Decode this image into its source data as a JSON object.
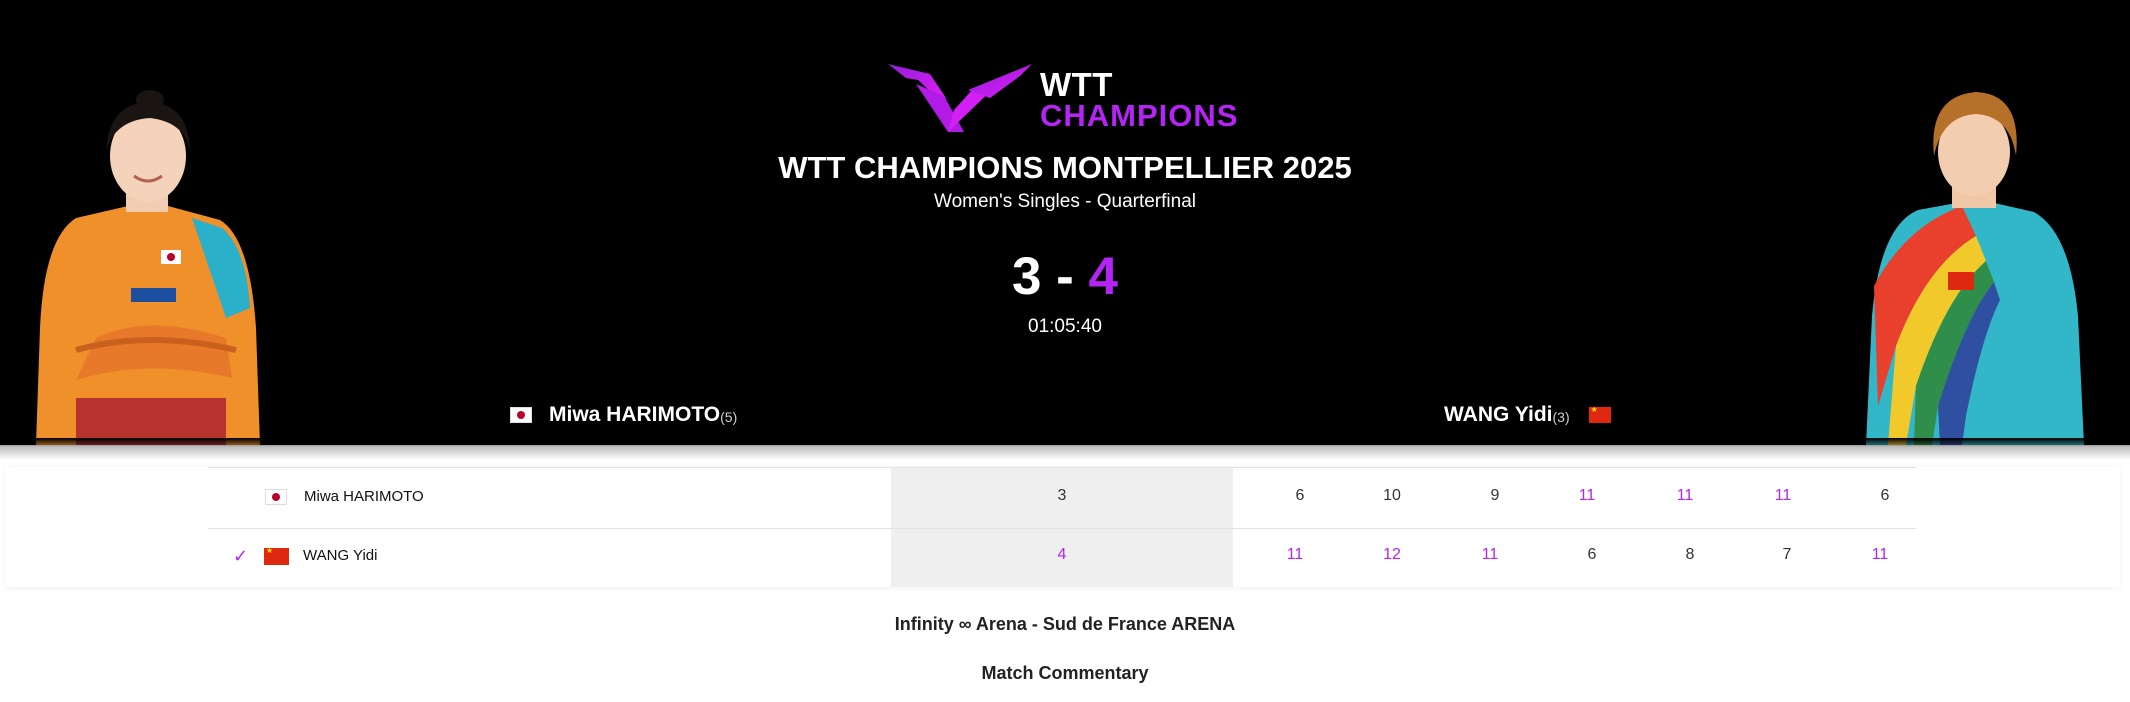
{
  "brand": {
    "logo_top": "WTT",
    "logo_bottom": "CHAMPIONS",
    "accent_color": "#b424f4",
    "logo_mark_color": "#c21ef0"
  },
  "event": {
    "title": "WTT CHAMPIONS MONTPELLIER 2025",
    "subtitle": "Women's Singles - Quarterfinal"
  },
  "match": {
    "score_p1": "3",
    "score_sep": " - ",
    "score_p2": "4",
    "duration": "01:05:40",
    "winner": "player2"
  },
  "players": {
    "p1": {
      "name": "Miwa HARIMOTO",
      "seed": "(5)",
      "flag": "jp-flag-icon",
      "table_name": "Miwa HARIMOTO"
    },
    "p2": {
      "name": "WANG Yidi",
      "seed": "(3)",
      "flag": "cn-flag-icon",
      "table_name": "WANG Yidi"
    }
  },
  "results": {
    "p1": {
      "sets": "3",
      "games": [
        "6",
        "10",
        "9",
        "11",
        "11",
        "11",
        "6"
      ]
    },
    "p2": {
      "sets": "4",
      "games": [
        "11",
        "12",
        "11",
        "6",
        "8",
        "7",
        "11"
      ]
    },
    "winner_icon": "check-icon"
  },
  "footer": {
    "venue": "Infinity ∞ Arena - Sud de France ARENA",
    "commentary": "Match Commentary"
  }
}
